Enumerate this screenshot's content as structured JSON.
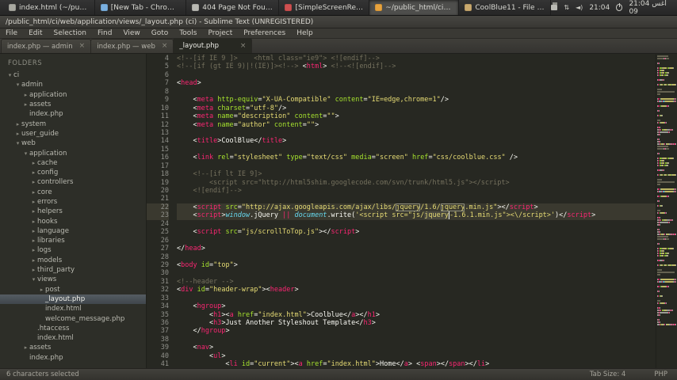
{
  "desktop": {
    "taskbar": [
      {
        "label": "index.html (~/public...",
        "icon": "text-file",
        "color": "#a9a9a1"
      },
      {
        "label": "[New Tab - Chromium]",
        "icon": "chromium",
        "color": "#7ab0e0"
      },
      {
        "label": "404 Page Not Found ...",
        "icon": "browser-page",
        "color": "#b9b9b3"
      },
      {
        "label": "[SimpleScreenRecor...",
        "icon": "screen-recorder",
        "color": "#cf5050"
      },
      {
        "label": "~/public_html/ci/we...",
        "icon": "sublime-text",
        "color": "#e8a33d",
        "active": true
      },
      {
        "label": "CoolBlue11 - File Ma...",
        "icon": "file-manager",
        "color": "#c9a96e"
      }
    ],
    "tray": {
      "time": "21:04",
      "datetime": "21:04 أغس 09"
    }
  },
  "window": {
    "title": "/public_html/ci/web/application/views/_layout.php (ci) - Sublime Text (UNREGISTERED)",
    "menu": [
      "File",
      "Edit",
      "Selection",
      "Find",
      "View",
      "Goto",
      "Tools",
      "Project",
      "Preferences",
      "Help"
    ]
  },
  "tabs": [
    {
      "label": "index.php — admin"
    },
    {
      "label": "index.php — web"
    },
    {
      "label": "_layout.php",
      "active": true
    }
  ],
  "sidebar": {
    "title": "FOLDERS",
    "items": [
      {
        "label": "ci",
        "d": 0,
        "k": "folder",
        "o": true
      },
      {
        "label": "admin",
        "d": 1,
        "k": "folder",
        "o": true
      },
      {
        "label": "application",
        "d": 2,
        "k": "folder",
        "o": false
      },
      {
        "label": "assets",
        "d": 2,
        "k": "folder",
        "o": false
      },
      {
        "label": "index.php",
        "d": 2,
        "k": "file"
      },
      {
        "label": "system",
        "d": 1,
        "k": "folder",
        "o": false
      },
      {
        "label": "user_guide",
        "d": 1,
        "k": "folder",
        "o": false
      },
      {
        "label": "web",
        "d": 1,
        "k": "folder",
        "o": true
      },
      {
        "label": "application",
        "d": 2,
        "k": "folder",
        "o": true
      },
      {
        "label": "cache",
        "d": 3,
        "k": "folder",
        "o": false
      },
      {
        "label": "config",
        "d": 3,
        "k": "folder",
        "o": false
      },
      {
        "label": "controllers",
        "d": 3,
        "k": "folder",
        "o": false
      },
      {
        "label": "core",
        "d": 3,
        "k": "folder",
        "o": false
      },
      {
        "label": "errors",
        "d": 3,
        "k": "folder",
        "o": false
      },
      {
        "label": "helpers",
        "d": 3,
        "k": "folder",
        "o": false
      },
      {
        "label": "hooks",
        "d": 3,
        "k": "folder",
        "o": false
      },
      {
        "label": "language",
        "d": 3,
        "k": "folder",
        "o": false
      },
      {
        "label": "libraries",
        "d": 3,
        "k": "folder",
        "o": false
      },
      {
        "label": "logs",
        "d": 3,
        "k": "folder",
        "o": false
      },
      {
        "label": "models",
        "d": 3,
        "k": "folder",
        "o": false
      },
      {
        "label": "third_party",
        "d": 3,
        "k": "folder",
        "o": false
      },
      {
        "label": "views",
        "d": 3,
        "k": "folder",
        "o": true
      },
      {
        "label": "post",
        "d": 4,
        "k": "folder",
        "o": false
      },
      {
        "label": "_layout.php",
        "d": 4,
        "k": "file",
        "selected": true
      },
      {
        "label": "index.html",
        "d": 4,
        "k": "file"
      },
      {
        "label": "welcome_message.php",
        "d": 4,
        "k": "file"
      },
      {
        "label": ".htaccess",
        "d": 3,
        "k": "file"
      },
      {
        "label": "index.html",
        "d": 3,
        "k": "file"
      },
      {
        "label": "assets",
        "d": 2,
        "k": "folder",
        "o": false
      },
      {
        "label": "index.php",
        "d": 2,
        "k": "file"
      }
    ]
  },
  "editor": {
    "lines": [
      {
        "n": 4,
        "tk": [
          [
            "<!--[if IE 9 ]>    <html class=\"ie9\"> <![endif]-->",
            "cm"
          ]
        ]
      },
      {
        "n": 5,
        "tk": [
          [
            "<!--[if (gt IE 9)|!(IE)]><!-->",
            "cm"
          ],
          [
            " <",
            "pl"
          ],
          [
            "html",
            "tg"
          ],
          [
            "> ",
            "pl"
          ],
          [
            "<!--<![endif]-->",
            "cm"
          ]
        ]
      },
      {
        "n": 6,
        "tk": []
      },
      {
        "n": 7,
        "tk": [
          [
            "<",
            "pl"
          ],
          [
            "head",
            "tg"
          ],
          [
            ">",
            "pl"
          ]
        ]
      },
      {
        "n": 8,
        "tk": []
      },
      {
        "n": 9,
        "tk": [
          [
            "    <",
            "pl"
          ],
          [
            "meta",
            "tg"
          ],
          [
            " ",
            "pl"
          ],
          [
            "http-equiv",
            "at"
          ],
          [
            "=",
            "pl"
          ],
          [
            "\"X-UA-Compatible\"",
            "st"
          ],
          [
            " ",
            "pl"
          ],
          [
            "content",
            "at"
          ],
          [
            "=",
            "pl"
          ],
          [
            "\"IE=edge,chrome=1\"",
            "st"
          ],
          [
            "/>",
            "pl"
          ]
        ]
      },
      {
        "n": 10,
        "tk": [
          [
            "    <",
            "pl"
          ],
          [
            "meta",
            "tg"
          ],
          [
            " ",
            "pl"
          ],
          [
            "charset",
            "at"
          ],
          [
            "=",
            "pl"
          ],
          [
            "\"utf-8\"",
            "st"
          ],
          [
            "/>",
            "pl"
          ]
        ]
      },
      {
        "n": 11,
        "tk": [
          [
            "    <",
            "pl"
          ],
          [
            "meta",
            "tg"
          ],
          [
            " ",
            "pl"
          ],
          [
            "name",
            "at"
          ],
          [
            "=",
            "pl"
          ],
          [
            "\"description\"",
            "st"
          ],
          [
            " ",
            "pl"
          ],
          [
            "content",
            "at"
          ],
          [
            "=",
            "pl"
          ],
          [
            "\"\"",
            "st"
          ],
          [
            ">",
            "pl"
          ]
        ]
      },
      {
        "n": 12,
        "tk": [
          [
            "    <",
            "pl"
          ],
          [
            "meta",
            "tg"
          ],
          [
            " ",
            "pl"
          ],
          [
            "name",
            "at"
          ],
          [
            "=",
            "pl"
          ],
          [
            "\"author\"",
            "st"
          ],
          [
            " ",
            "pl"
          ],
          [
            "content",
            "at"
          ],
          [
            "=",
            "pl"
          ],
          [
            "\"\"",
            "st"
          ],
          [
            ">",
            "pl"
          ]
        ]
      },
      {
        "n": 13,
        "tk": []
      },
      {
        "n": 14,
        "tk": [
          [
            "    <",
            "pl"
          ],
          [
            "title",
            "tg"
          ],
          [
            ">",
            "pl"
          ],
          [
            "CoolBlue",
            "pl"
          ],
          [
            "</",
            "pl"
          ],
          [
            "title",
            "tg"
          ],
          [
            ">",
            "pl"
          ]
        ]
      },
      {
        "n": 15,
        "tk": []
      },
      {
        "n": 16,
        "tk": [
          [
            "    <",
            "pl"
          ],
          [
            "link",
            "tg"
          ],
          [
            " ",
            "pl"
          ],
          [
            "rel",
            "at"
          ],
          [
            "=",
            "pl"
          ],
          [
            "\"stylesheet\"",
            "st"
          ],
          [
            " ",
            "pl"
          ],
          [
            "type",
            "at"
          ],
          [
            "=",
            "pl"
          ],
          [
            "\"text/css\"",
            "st"
          ],
          [
            " ",
            "pl"
          ],
          [
            "media",
            "at"
          ],
          [
            "=",
            "pl"
          ],
          [
            "\"screen\"",
            "st"
          ],
          [
            " ",
            "pl"
          ],
          [
            "href",
            "at"
          ],
          [
            "=",
            "pl"
          ],
          [
            "\"css/coolblue.css\"",
            "st"
          ],
          [
            " />",
            "pl"
          ]
        ]
      },
      {
        "n": 17,
        "tk": []
      },
      {
        "n": 18,
        "tk": [
          [
            "    <!--[if lt IE 9]>",
            "cm"
          ]
        ]
      },
      {
        "n": 19,
        "tk": [
          [
            "        <script src=\"http://html5shim.googlecode.com/svn/trunk/html5.js\"></script>",
            "cm"
          ]
        ]
      },
      {
        "n": 20,
        "tk": [
          [
            "    <![endif]-->",
            "cm"
          ]
        ]
      },
      {
        "n": 21,
        "tk": []
      },
      {
        "n": 22,
        "active": true,
        "tk": [
          [
            "    <",
            "pl"
          ],
          [
            "script",
            "tg"
          ],
          [
            " ",
            "pl"
          ],
          [
            "src",
            "at"
          ],
          [
            "=",
            "pl"
          ],
          [
            "\"http://ajax.googleapis.com/ajax/libs/",
            "st"
          ],
          [
            "jquery",
            "st",
            "find"
          ],
          [
            "/1.6/",
            "st"
          ],
          [
            "jquery",
            "st",
            "find"
          ],
          [
            ".min.js\"",
            "st"
          ],
          [
            "></",
            "pl"
          ],
          [
            "script",
            "tg"
          ],
          [
            ">",
            "pl"
          ]
        ]
      },
      {
        "n": 23,
        "active": true,
        "tk": [
          [
            "    <",
            "pl"
          ],
          [
            "script",
            "tg"
          ],
          [
            ">",
            "pl"
          ],
          [
            "window",
            "kw"
          ],
          [
            ".jQuery ",
            "pl"
          ],
          [
            "||",
            "op"
          ],
          [
            " ",
            "pl"
          ],
          [
            "document",
            "kw"
          ],
          [
            ".write(",
            "pl"
          ],
          [
            "'<script src=\"js/",
            "st"
          ],
          [
            "jquery",
            "st",
            "sel"
          ],
          [
            "-1.6.1.min.js\"><\\/script>'",
            "st"
          ],
          [
            ")",
            "pl"
          ],
          [
            "</",
            "pl"
          ],
          [
            "script",
            "tg"
          ],
          [
            ">",
            "pl"
          ]
        ]
      },
      {
        "n": 24,
        "tk": []
      },
      {
        "n": 25,
        "tk": [
          [
            "    <",
            "pl"
          ],
          [
            "script",
            "tg"
          ],
          [
            " ",
            "pl"
          ],
          [
            "src",
            "at"
          ],
          [
            "=",
            "pl"
          ],
          [
            "\"js/scrollToTop.js\"",
            "st"
          ],
          [
            "></",
            "pl"
          ],
          [
            "script",
            "tg"
          ],
          [
            ">",
            "pl"
          ]
        ]
      },
      {
        "n": 26,
        "tk": []
      },
      {
        "n": 27,
        "tk": [
          [
            "</",
            "pl"
          ],
          [
            "head",
            "tg"
          ],
          [
            ">",
            "pl"
          ]
        ]
      },
      {
        "n": 28,
        "tk": []
      },
      {
        "n": 29,
        "tk": [
          [
            "<",
            "pl"
          ],
          [
            "body",
            "tg"
          ],
          [
            " ",
            "pl"
          ],
          [
            "id",
            "at"
          ],
          [
            "=",
            "pl"
          ],
          [
            "\"top\"",
            "st"
          ],
          [
            ">",
            "pl"
          ]
        ]
      },
      {
        "n": 30,
        "tk": []
      },
      {
        "n": 31,
        "tk": [
          [
            "<!--header -->",
            "cm"
          ]
        ]
      },
      {
        "n": 32,
        "tk": [
          [
            "<",
            "pl"
          ],
          [
            "div",
            "tg"
          ],
          [
            " ",
            "pl"
          ],
          [
            "id",
            "at"
          ],
          [
            "=",
            "pl"
          ],
          [
            "\"header-wrap\"",
            "st"
          ],
          [
            "><",
            "pl"
          ],
          [
            "header",
            "tg"
          ],
          [
            ">",
            "pl"
          ]
        ]
      },
      {
        "n": 33,
        "tk": []
      },
      {
        "n": 34,
        "tk": [
          [
            "    <",
            "pl"
          ],
          [
            "hgroup",
            "tg"
          ],
          [
            ">",
            "pl"
          ]
        ]
      },
      {
        "n": 35,
        "tk": [
          [
            "        <",
            "pl"
          ],
          [
            "h1",
            "tg"
          ],
          [
            "><",
            "pl"
          ],
          [
            "a",
            "tg"
          ],
          [
            " ",
            "pl"
          ],
          [
            "href",
            "at"
          ],
          [
            "=",
            "pl"
          ],
          [
            "\"index.html\"",
            "st"
          ],
          [
            ">",
            "pl"
          ],
          [
            "Coolblue",
            "pl"
          ],
          [
            "</",
            "pl"
          ],
          [
            "a",
            "tg"
          ],
          [
            "></",
            "pl"
          ],
          [
            "h1",
            "tg"
          ],
          [
            ">",
            "pl"
          ]
        ]
      },
      {
        "n": 36,
        "tk": [
          [
            "        <",
            "pl"
          ],
          [
            "h3",
            "tg"
          ],
          [
            ">",
            "pl"
          ],
          [
            "Just Another Styleshout Template",
            "pl"
          ],
          [
            "</",
            "pl"
          ],
          [
            "h3",
            "tg"
          ],
          [
            ">",
            "pl"
          ]
        ]
      },
      {
        "n": 37,
        "tk": [
          [
            "    </",
            "pl"
          ],
          [
            "hgroup",
            "tg"
          ],
          [
            ">",
            "pl"
          ]
        ]
      },
      {
        "n": 38,
        "tk": []
      },
      {
        "n": 39,
        "tk": [
          [
            "    <",
            "pl"
          ],
          [
            "nav",
            "tg"
          ],
          [
            ">",
            "pl"
          ]
        ]
      },
      {
        "n": 40,
        "tk": [
          [
            "        <",
            "pl"
          ],
          [
            "ul",
            "tg"
          ],
          [
            ">",
            "pl"
          ]
        ]
      },
      {
        "n": 41,
        "tk": [
          [
            "            <",
            "pl"
          ],
          [
            "li",
            "tg"
          ],
          [
            " ",
            "pl"
          ],
          [
            "id",
            "at"
          ],
          [
            "=",
            "pl"
          ],
          [
            "\"current\"",
            "st"
          ],
          [
            "><",
            "pl"
          ],
          [
            "a",
            "tg"
          ],
          [
            " ",
            "pl"
          ],
          [
            "href",
            "at"
          ],
          [
            "=",
            "pl"
          ],
          [
            "\"index.html\"",
            "st"
          ],
          [
            ">",
            "pl"
          ],
          [
            "Home",
            "pl"
          ],
          [
            "</",
            "pl"
          ],
          [
            "a",
            "tg"
          ],
          [
            "> <",
            "pl"
          ],
          [
            "span",
            "tg"
          ],
          [
            "></",
            "pl"
          ],
          [
            "span",
            "tg"
          ],
          [
            "></",
            "pl"
          ],
          [
            "li",
            "tg"
          ],
          [
            ">",
            "pl"
          ]
        ]
      }
    ]
  },
  "status": {
    "left": "6 characters selected",
    "tab_size": "Tab Size: 4",
    "syntax": "PHP"
  }
}
